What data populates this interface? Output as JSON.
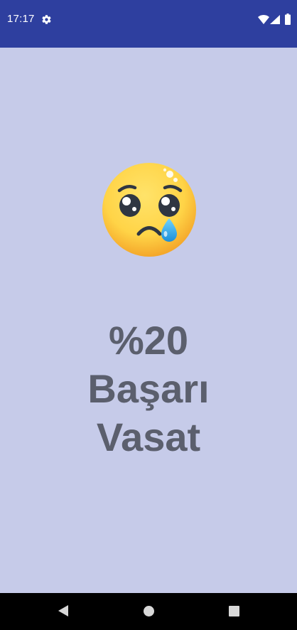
{
  "status_bar": {
    "time": "17:17",
    "background": "#2e3f9f",
    "icons": [
      "gear-icon",
      "wifi-icon",
      "signal-icon",
      "battery-icon"
    ]
  },
  "main": {
    "background": "#c6cbe9",
    "emoji": "sad-crying-face",
    "percentage": "%20",
    "success_label": "Başarı",
    "rating": "Vasat",
    "text_color": "#5b5f6d"
  },
  "nav_bar": {
    "buttons": [
      "back",
      "home",
      "recents"
    ]
  }
}
